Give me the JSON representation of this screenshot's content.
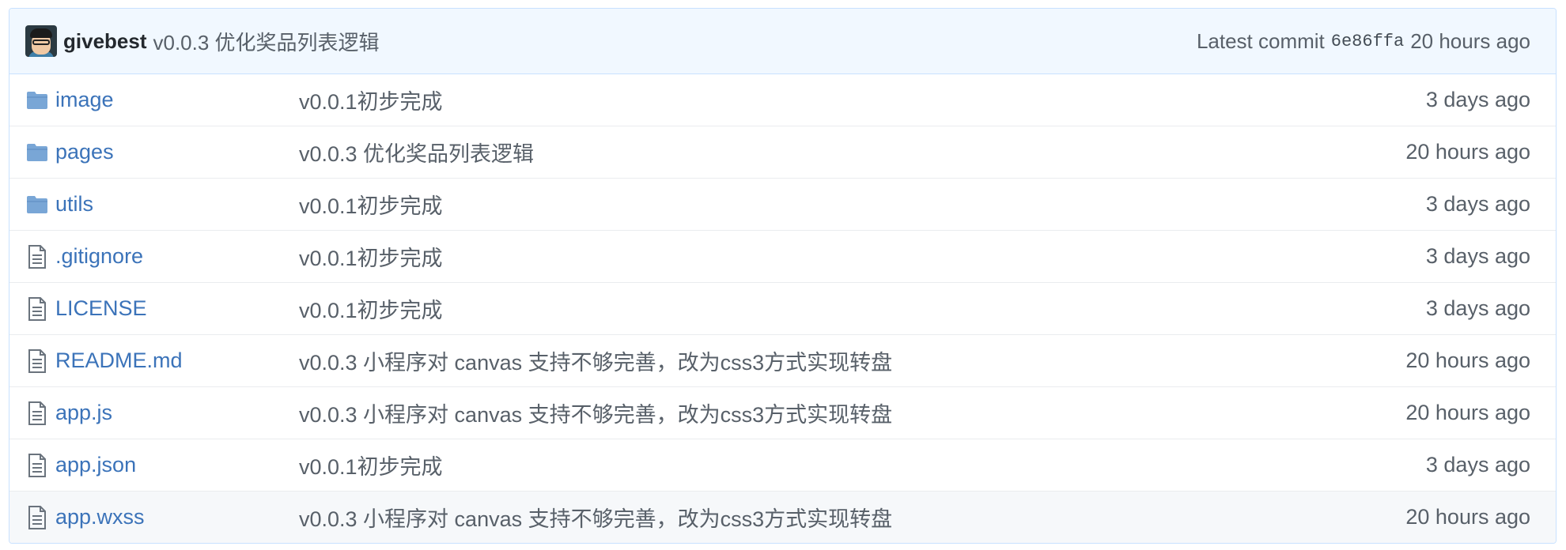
{
  "commit": {
    "author": "givebest",
    "message": "v0.0.3 优化奖品列表逻辑",
    "latest_label": "Latest commit",
    "sha": "6e86ffa",
    "age": "20 hours ago"
  },
  "colors": {
    "link": "#3b73b9",
    "folder": "#79b8ff",
    "header_bg": "#f1f8ff",
    "border": "#c8e1ff",
    "muted": "#586069"
  },
  "files": [
    {
      "type": "folder",
      "icon": "folder-icon",
      "name": "image",
      "message": "v0.0.1初步完成",
      "age": "3 days ago"
    },
    {
      "type": "folder",
      "icon": "folder-icon",
      "name": "pages",
      "message": "v0.0.3 优化奖品列表逻辑",
      "age": "20 hours ago"
    },
    {
      "type": "folder",
      "icon": "folder-icon",
      "name": "utils",
      "message": "v0.0.1初步完成",
      "age": "3 days ago"
    },
    {
      "type": "file",
      "icon": "file-icon",
      "name": ".gitignore",
      "message": "v0.0.1初步完成",
      "age": "3 days ago"
    },
    {
      "type": "file",
      "icon": "file-icon",
      "name": "LICENSE",
      "message": "v0.0.1初步完成",
      "age": "3 days ago"
    },
    {
      "type": "file",
      "icon": "file-icon",
      "name": "README.md",
      "message": "v0.0.3 小程序对 canvas 支持不够完善，改为css3方式实现转盘",
      "age": "20 hours ago"
    },
    {
      "type": "file",
      "icon": "file-icon",
      "name": "app.js",
      "message": "v0.0.3 小程序对 canvas 支持不够完善，改为css3方式实现转盘",
      "age": "20 hours ago"
    },
    {
      "type": "file",
      "icon": "file-icon",
      "name": "app.json",
      "message": "v0.0.1初步完成",
      "age": "3 days ago"
    },
    {
      "type": "file",
      "icon": "file-icon",
      "name": "app.wxss",
      "message": "v0.0.3 小程序对 canvas 支持不够完善，改为css3方式实现转盘",
      "age": "20 hours ago"
    }
  ]
}
